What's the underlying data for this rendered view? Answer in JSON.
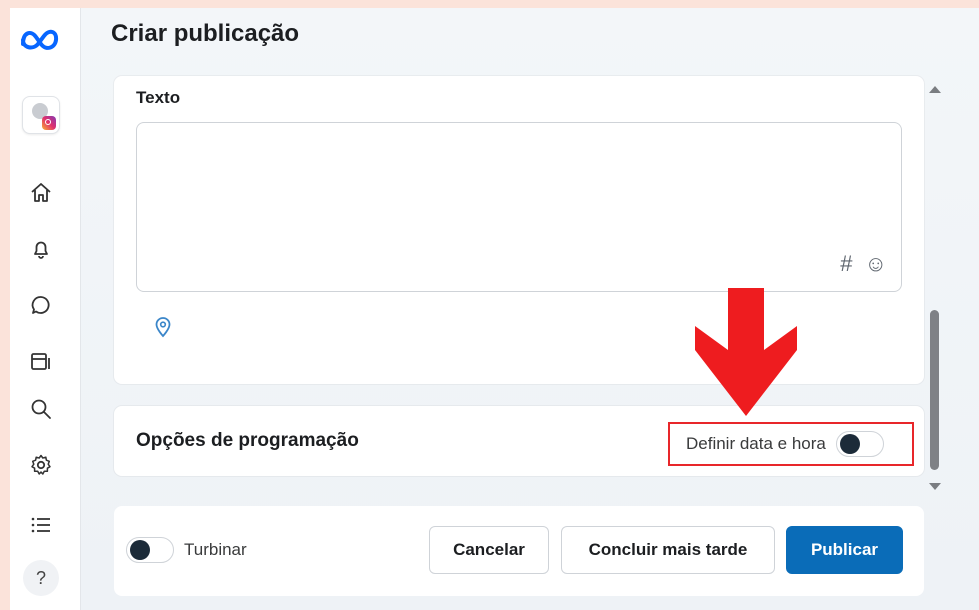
{
  "page": {
    "title": "Criar publicação"
  },
  "text_section": {
    "label": "Texto",
    "hashtag_glyph": "#",
    "emoji_glyph": "☺"
  },
  "schedule": {
    "title": "Opções de programação",
    "toggle_label": "Definir data e hora",
    "toggle_on": false
  },
  "footer": {
    "boost_label": "Turbinar",
    "boost_on": false,
    "cancel_label": "Cancelar",
    "later_label": "Concluir mais tarde",
    "publish_label": "Publicar"
  },
  "sidebar": {
    "items": [
      {
        "icon": "home-icon"
      },
      {
        "icon": "bell-icon"
      },
      {
        "icon": "chat-icon"
      },
      {
        "icon": "media-icon"
      },
      {
        "icon": "search-icon"
      },
      {
        "icon": "gear-icon"
      },
      {
        "icon": "list-icon"
      }
    ],
    "help_glyph": "?"
  },
  "colors": {
    "accent": "#0a6cb8",
    "highlight": "#e8262a"
  }
}
